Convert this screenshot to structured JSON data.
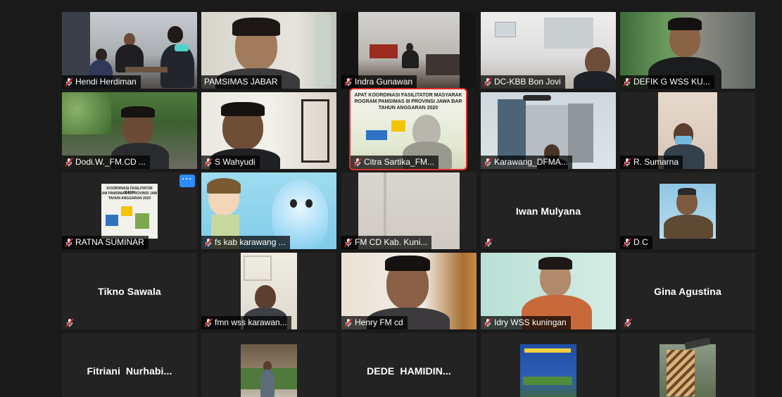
{
  "colors": {
    "background": "#1a1a1a",
    "tile": "#232323",
    "active_speaker_border": "#c9e05a",
    "pinned_border": "#e02b2b",
    "muted_icon": "#e02b2b",
    "more_button": "#2d8cff"
  },
  "participants": [
    {
      "name": "Hendi Herdiman",
      "muted": true
    },
    {
      "name": "PAMSIMAS JABAR",
      "muted": false
    },
    {
      "name": "Indra Gunawan",
      "muted": true
    },
    {
      "name": "DC-KBB Bon Jovi",
      "muted": true
    },
    {
      "name": "DEFIK G WSS KU...",
      "muted": true
    },
    {
      "name": "Dodi.W._FM.CD ...",
      "muted": true
    },
    {
      "name": "S Wahyudi",
      "muted": true
    },
    {
      "name": "Citra Sartika_FM...",
      "muted": true
    },
    {
      "name": "Karawang_DFMA...",
      "muted": true
    },
    {
      "name": "R. Sumarna",
      "muted": true
    },
    {
      "name": "RATNA SUMINAR",
      "muted": true
    },
    {
      "name": "fs kab karawang ...",
      "muted": true
    },
    {
      "name": "FM CD Kab. Kuni...",
      "muted": true
    },
    {
      "name": "Iwan Mulyana",
      "muted": true
    },
    {
      "name": "D C",
      "muted": true
    },
    {
      "name": "Tikno Sawala",
      "muted": true
    },
    {
      "name": "fmn wss karawan...",
      "muted": true
    },
    {
      "name": "Henry FM cd",
      "muted": true
    },
    {
      "name": "Idry WSS kuningan",
      "muted": true
    },
    {
      "name": "Gina Agustina",
      "muted": true
    },
    {
      "name": "Fitriani  Nurhabi...",
      "muted": false
    },
    {
      "name": "DEDE  HAMIDIN...",
      "muted": false
    }
  ],
  "slide": {
    "line1": "APAT KOORDINASI FASILITATOR MASYARAK",
    "line2": "ROGRAM PAMSIMAS III PROVINSI JAWA BAR",
    "line3": "TAHUN ANGGARAN 2020"
  },
  "slide_small": {
    "line1": "KOORDINASI FASILITATOR MASY",
    "line2": "AM PAMSIMAS III PROVINSI JAW",
    "line3": "TAHUN ANGGARAN 2020"
  },
  "more_button_label": "···",
  "icons": {
    "muted": "mic-muted-icon",
    "more": "more-options-icon"
  }
}
